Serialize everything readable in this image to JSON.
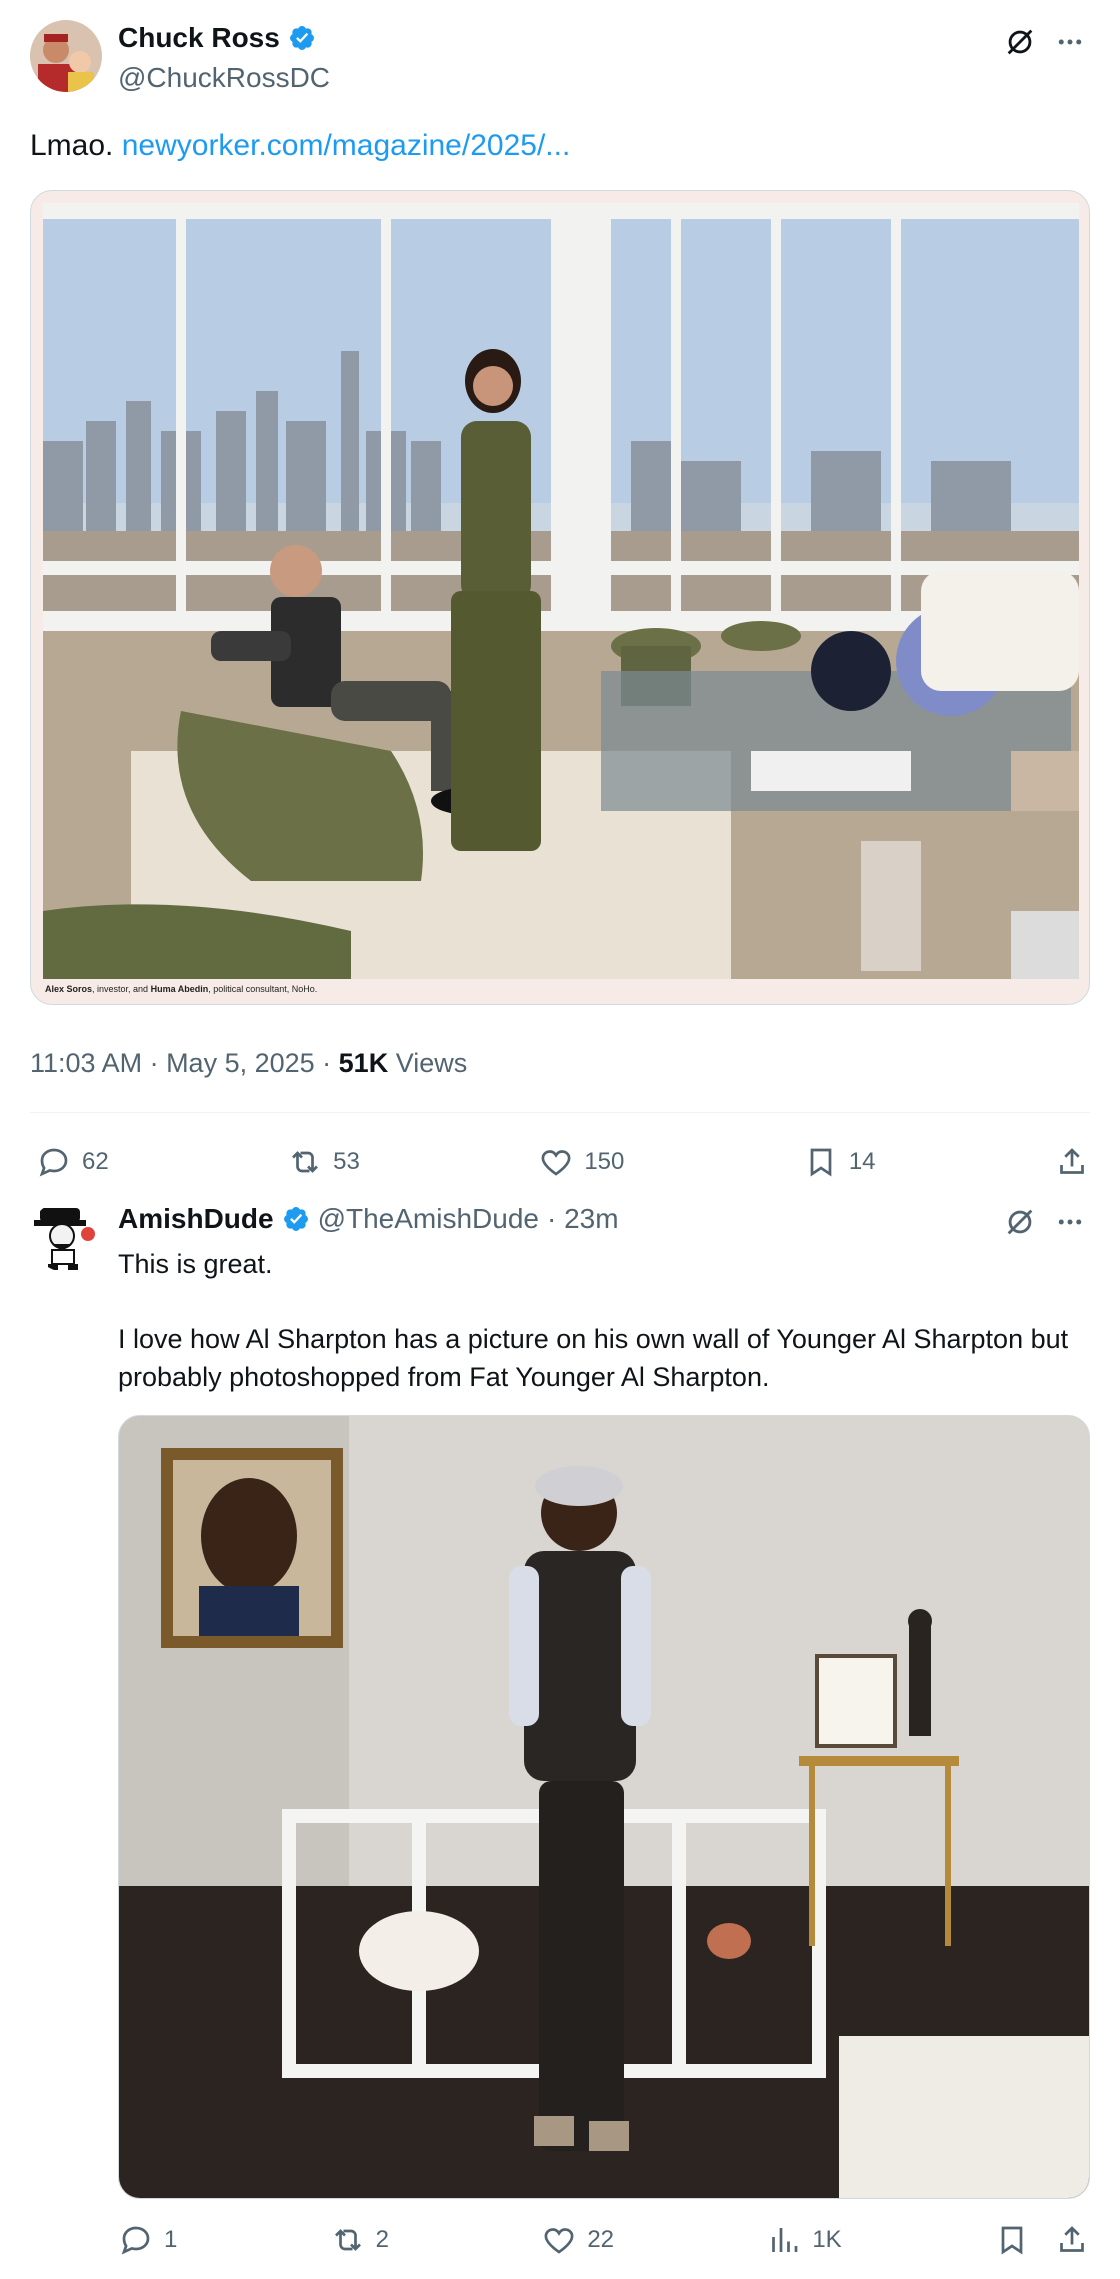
{
  "tweet": {
    "author": {
      "name": "Chuck Ross",
      "handle": "@ChuckRossDC"
    },
    "text_prefix": "Lmao. ",
    "link_text": "newyorker.com/magazine/2025/...",
    "image_caption_name1": "Alex Soros",
    "image_caption_mid": ", investor, and ",
    "image_caption_name2": "Huma Abedin",
    "image_caption_end": ", political consultant, NoHo.",
    "time": "11:03 AM · May 5, 2025 · ",
    "views_count": "51K",
    "views_label": " Views",
    "actions": {
      "replies": "62",
      "reposts": "53",
      "likes": "150",
      "bookmarks": "14"
    }
  },
  "reply": {
    "author": {
      "name": "AmishDude",
      "handle": "@TheAmishDude",
      "time": "· 23m"
    },
    "text_line1": "This is great.",
    "text_line2": "I love how Al Sharpton has a picture on his own wall of Younger Al Sharpton but probably photoshopped from Fat Younger Al Sharpton.",
    "actions": {
      "replies": "1",
      "reposts": "2",
      "likes": "22",
      "views": "1K"
    }
  },
  "colors": {
    "accent": "#1d9bf0",
    "text": "#0f1419",
    "secondary": "#536471"
  }
}
